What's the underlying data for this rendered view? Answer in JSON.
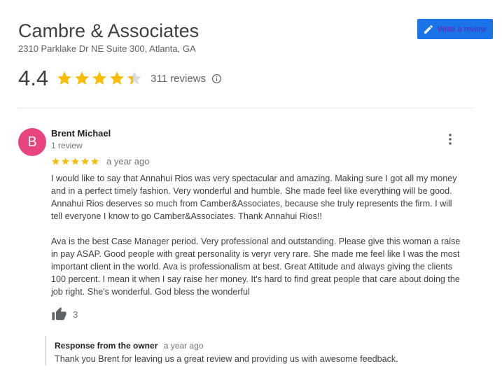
{
  "business": {
    "name": "Cambre & Associates",
    "address": "2310 Parklake Dr NE Suite 300, Atlanta, GA"
  },
  "write_review": {
    "label": "Write a review",
    "icon": "pencil-icon",
    "color": "#1a73e8"
  },
  "summary": {
    "average": "4.4",
    "rating_value": 4.4,
    "max_rating": 5,
    "count_label": "311 reviews",
    "star_color": "#fbbc04"
  },
  "review": {
    "avatar_letter": "B",
    "avatar_color": "#e8447d",
    "author": "Brent Michael",
    "author_meta": "1 review",
    "rating": 5,
    "date": "a year ago",
    "paragraphs": [
      "I would like to say that Annahui Rios was very spectacular and amazing. Making sure I got all my money\nand in a perfect timely fashion. Very wonderful and humble. She made feel like everything will be good.\nAnnahui Rios deserves so much from Camber&Associates, because she truly represents the firm. I will\ntell everyone I know to go Camber&Associates. Thank Annahui Rios!!",
      "Ava is the best Case Manager period. Very professional and outstanding. Please give this woman a raise\nin pay ASAP. Good people with great personality is veryr very  rare. She made me feel like I was the most\nimportant client in the world. Ava is professionalism at best. Great Attitude and always giving the clients\n100 percent. I mean it when I say raise her money. It's hard to find great people that care about doing the\njob right. She's wonderful. God bless the wonderful"
    ],
    "likes": "3"
  },
  "owner_response": {
    "title": "Response from the owner",
    "date": "a year ago",
    "text": "Thank you Brent for leaving us a great review and providing us with awesome feedback."
  }
}
